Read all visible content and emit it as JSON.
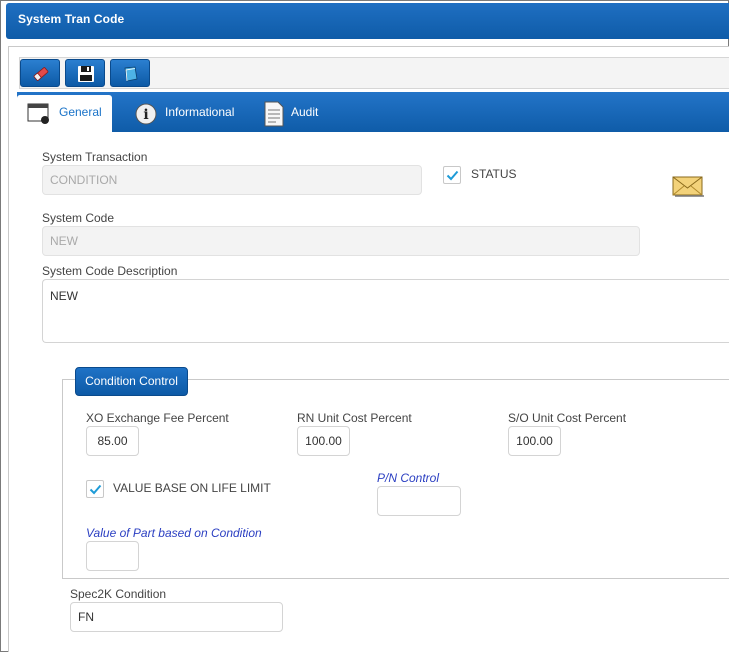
{
  "window": {
    "title": "System Tran Code"
  },
  "toolbar": {
    "buttons": [
      {
        "name": "eraser"
      },
      {
        "name": "save"
      },
      {
        "name": "book"
      }
    ]
  },
  "tabs": [
    {
      "label": "General",
      "active": true,
      "icon": "window-icon"
    },
    {
      "label": "Informational",
      "active": false,
      "icon": "info-icon"
    },
    {
      "label": "Audit",
      "active": false,
      "icon": "document-icon"
    }
  ],
  "form": {
    "system_transaction": {
      "label": "System Transaction",
      "value": "CONDITION"
    },
    "status": {
      "label": "STATUS",
      "checked": true
    },
    "system_code": {
      "label": "System Code",
      "value": "NEW"
    },
    "system_code_description": {
      "label": "System Code Description",
      "value": "NEW"
    }
  },
  "condition_control": {
    "title": "Condition Control",
    "xo_exchange_fee_percent": {
      "label": "XO Exchange Fee Percent",
      "value": "85.00"
    },
    "rn_unit_cost_percent": {
      "label": "RN Unit Cost Percent",
      "value": "100.00"
    },
    "so_unit_cost_percent": {
      "label": "S/O Unit Cost Percent",
      "value": "100.00"
    },
    "value_base_on_life_limit": {
      "label": "VALUE BASE ON LIFE LIMIT",
      "checked": true
    },
    "pn_control": {
      "label": "P/N Control",
      "value": ""
    },
    "value_of_part": {
      "label": "Value of Part based on Condition",
      "value": ""
    }
  },
  "spec2k": {
    "label": "Spec2K Condition",
    "value": "FN"
  },
  "colors": {
    "accent": "#0f5ca8",
    "check": "#1e9bd7",
    "italic_label": "#2b3fc2"
  }
}
